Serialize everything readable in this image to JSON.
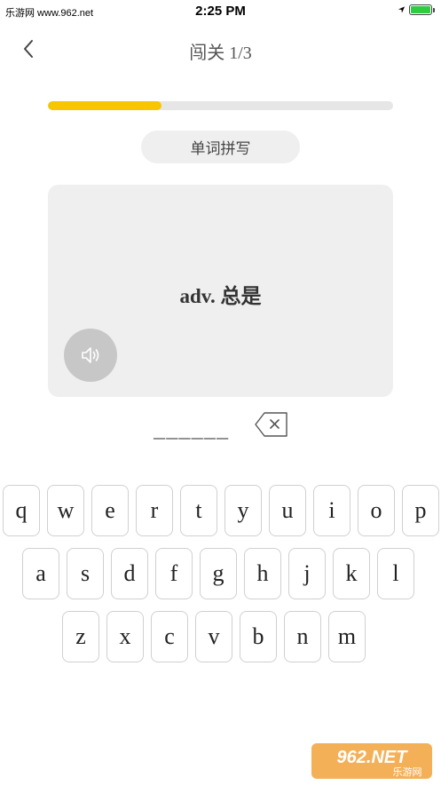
{
  "status_bar": {
    "left_text": "乐游网 www.962.net",
    "time": "2:25 PM",
    "battery_percent": 100
  },
  "nav": {
    "back_icon": "chevron-left-icon",
    "title": "闯关 1/3"
  },
  "progress": {
    "fraction": 0.33,
    "color": "#f7c600"
  },
  "mode": {
    "label": "单词拼写"
  },
  "card": {
    "definition": "adv. 总是",
    "speaker_icon": "speaker-icon"
  },
  "answer": {
    "blanks": "______",
    "backspace_icon": "backspace-icon"
  },
  "keyboard": {
    "row1": [
      "q",
      "w",
      "e",
      "r",
      "t",
      "y",
      "u",
      "i",
      "o",
      "p"
    ],
    "row2": [
      "a",
      "s",
      "d",
      "f",
      "g",
      "h",
      "j",
      "k",
      "l"
    ],
    "row3": [
      "z",
      "x",
      "c",
      "v",
      "b",
      "n",
      "m"
    ]
  },
  "watermark": {
    "brand": "962.NET",
    "subtitle": "乐游网"
  }
}
